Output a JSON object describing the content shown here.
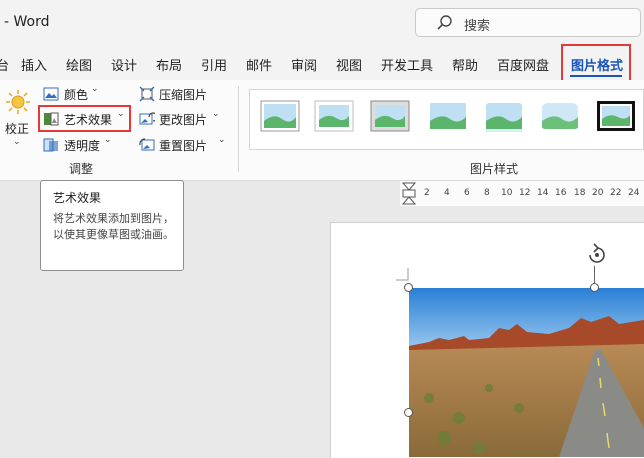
{
  "titlebar": {
    "title": "- Word",
    "search_placeholder": "搜索"
  },
  "tabs": [
    "ä",
    "插入",
    "绘图",
    "设计",
    "布局",
    "引用",
    "邮件",
    "审阅",
    "视图",
    "开发工具",
    "帮助",
    "百度网盘"
  ],
  "active_tab": "图片格式",
  "ribbon": {
    "correct": "校正",
    "color": "颜色",
    "artistic": "艺术效果",
    "transparency": "透明度",
    "compress": "压缩图片",
    "change": "更改图片",
    "reset": "重置图片",
    "group_adjust": "调整",
    "group_style": "图片样式"
  },
  "tooltip": {
    "title": "艺术效果",
    "body": "将艺术效果添加到图片，以使其更像草图或油画。"
  },
  "ruler": [
    "2",
    "4",
    "6",
    "8",
    "10",
    "12",
    "14",
    "16",
    "18",
    "20",
    "22",
    "24"
  ],
  "colors": {
    "accent": "#1a55b8",
    "highlight": "#e53935"
  }
}
